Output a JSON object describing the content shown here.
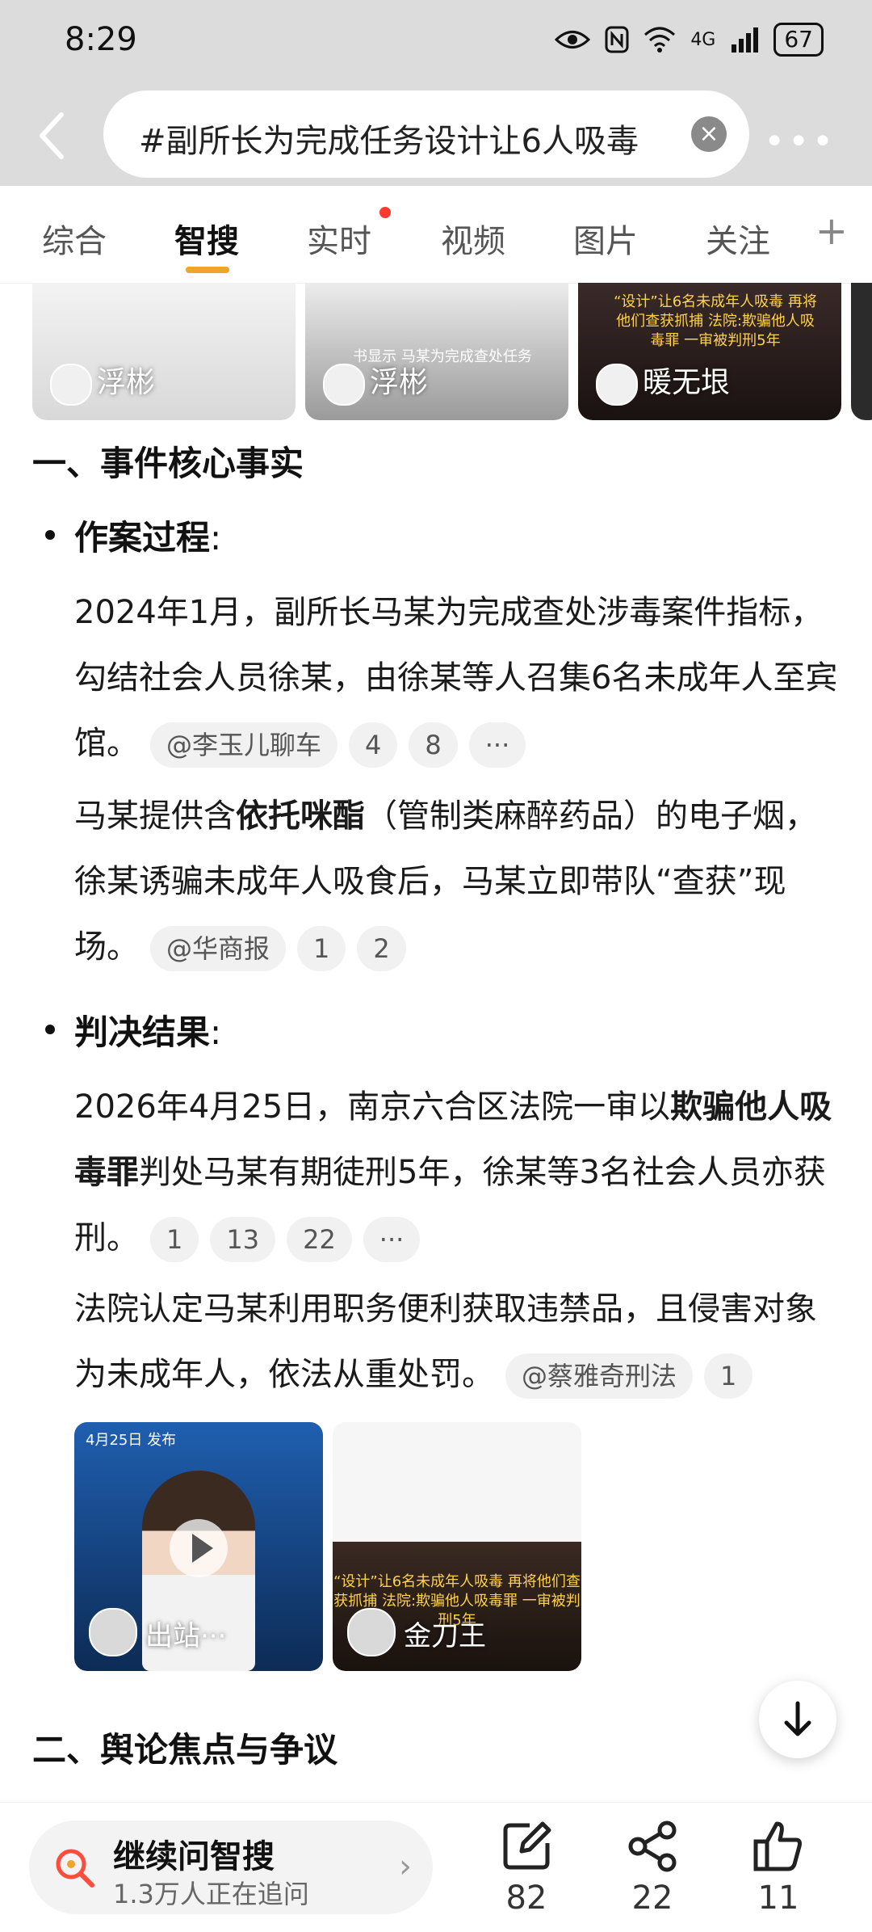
{
  "status_bar": {
    "time": "8:29",
    "battery": "67",
    "network": "4G"
  },
  "search": {
    "query": "#副所长为完成任务设计让6人吸毒"
  },
  "tabs": [
    {
      "label": "综合"
    },
    {
      "label": "智搜"
    },
    {
      "label": "实时"
    },
    {
      "label": "视频"
    },
    {
      "label": "图片"
    },
    {
      "label": "关注"
    }
  ],
  "thumbnails": [
    {
      "name": "浮彬"
    },
    {
      "name": "浮彬",
      "caption": "书显示 马某为完成查处任务"
    },
    {
      "name": "暖无垠",
      "caption": "“设计”让6名未成年人吸毒 再将他们查获抓捕 法院:欺骗他人吸毒罪 一审被判刑5年"
    }
  ],
  "section1": {
    "heading": "一、事件核心事实",
    "sub1": {
      "title": "作案过程",
      "colon": ":",
      "p1_text": "2024年1月，副所长马某为完成查处涉毒案件指标，勾结社会人员徐某，由徐某等人召集6名未成年人至宾馆。",
      "p1_chips": [
        "@李玉儿聊车",
        "4",
        "8",
        "···"
      ],
      "p2_pre": "马某提供含",
      "p2_bold": "依托咪酯",
      "p2_post": "（管制类麻醉药品）的电子烟，徐某诱骗未成年人吸食后，马某立即带队“查获”现场。",
      "p2_chips": [
        "@华商报",
        "1",
        "2"
      ]
    },
    "sub2": {
      "title": "判决结果",
      "colon": ":",
      "p1_pre": "2026年4月25日，南京六合区法院一审以",
      "p1_bold": "欺骗他人吸毒罪",
      "p1_post": "判处马某有期徒刑5年，徐某等3名社会人员亦获刑。",
      "p1_chips": [
        "1",
        "13",
        "22",
        "···"
      ],
      "p2_text": "法院认定马某利用职务便利获取违禁品，且侵害对象为未成年人，依法从重处罚。",
      "p2_chips": [
        "@蔡雅奇刑法",
        "1"
      ]
    }
  },
  "media": [
    {
      "date": "4月25日 发布",
      "name": "出站···"
    },
    {
      "name": "金刀王",
      "caption": "“设计”让6名未成年人吸毒 再将他们查获抓捕 法院:欺骗他人吸毒罪 一审被判刑5年"
    }
  ],
  "section2": {
    "heading": "二、舆论焦点与争议"
  },
  "bottom_bar": {
    "ask_title": "继续问智搜",
    "ask_sub": "1.3万人正在追问",
    "comment_count": "82",
    "share_count": "22",
    "like_count": "11"
  },
  "colors": {
    "accent": "#f2a32c",
    "dot": "#ff3b30",
    "ask_icon": "#ff4d3d"
  }
}
